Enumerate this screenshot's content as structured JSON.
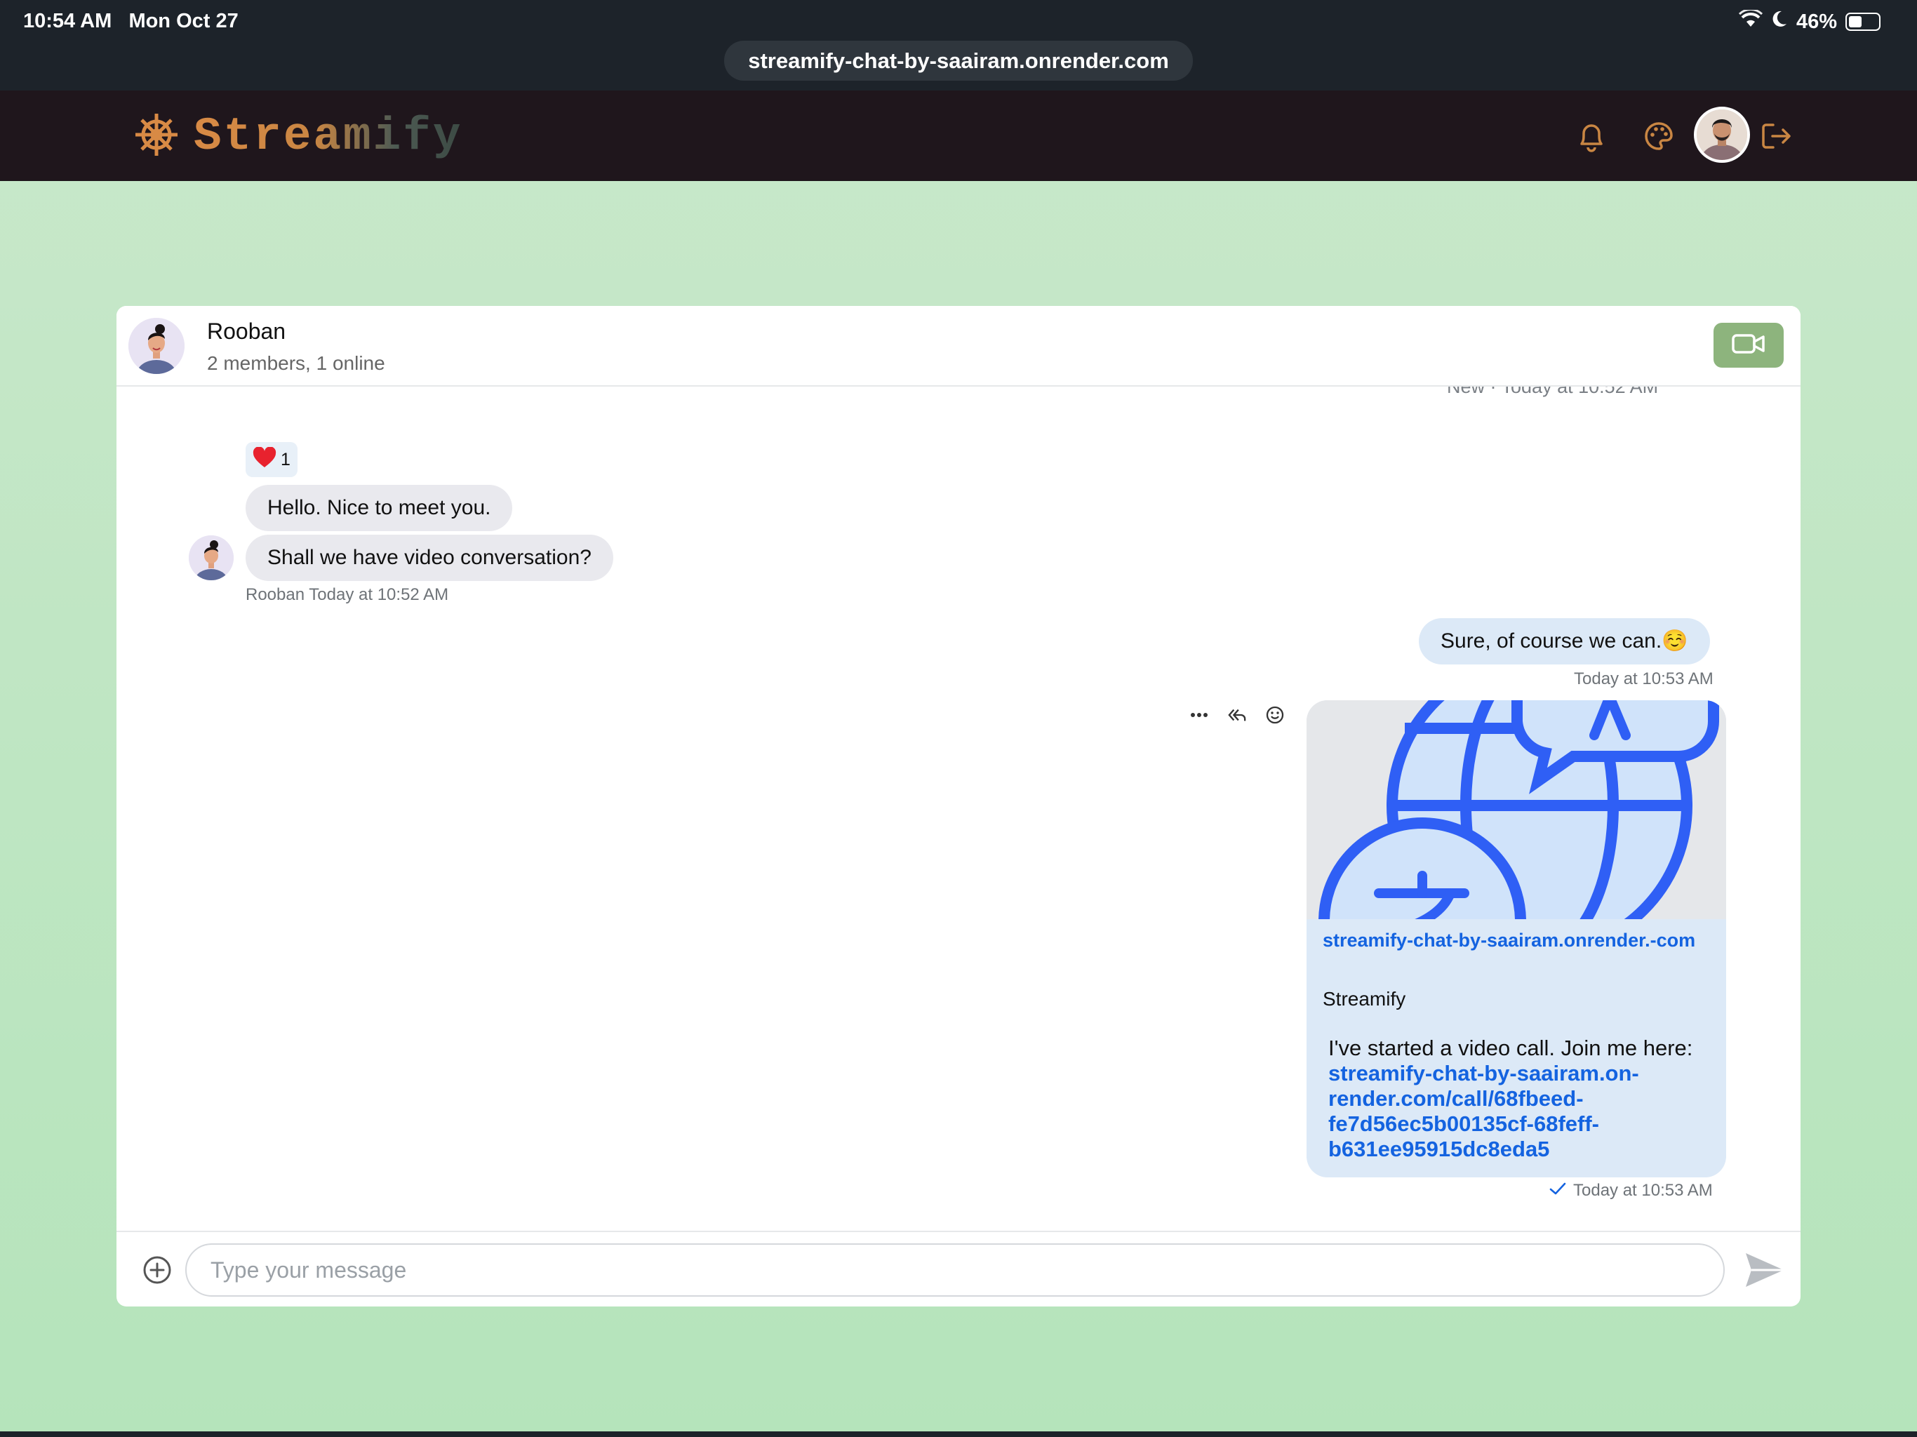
{
  "status_bar": {
    "time": "10:54 AM",
    "date": "Mon Oct 27",
    "battery": "46%",
    "battery_level": 0.46,
    "icons": [
      "wifi-icon",
      "moon-icon",
      "battery-icon"
    ]
  },
  "browser": {
    "url": "streamify-chat-by-saairam.onrender.com"
  },
  "header": {
    "brand": "Streamify",
    "logo_icon": "ship-wheel-icon",
    "actions": [
      "bell-icon",
      "palette-icon",
      "avatar",
      "logout-icon"
    ]
  },
  "colors": {
    "accent": "#8db47d",
    "brand_orange": "#d88a45",
    "link": "#1463e0"
  },
  "chat": {
    "channel_name": "Rooban",
    "members_status": "2 members, 1 online",
    "clipped_date": "New · Today at 10:52 AM",
    "messages": [
      {
        "direction": "incoming",
        "reaction": {
          "emoji": "❤️",
          "count": "1"
        },
        "texts": [
          "Hello. Nice to meet you.",
          "Shall we have video conversation?"
        ],
        "meta": "Rooban Today at 10:52 AM"
      },
      {
        "direction": "outgoing",
        "text": "Sure, of course we can.☺️",
        "meta": "Today at 10:53 AM"
      },
      {
        "direction": "outgoing",
        "attachment": {
          "link": "streamify-chat-by-saairam.onrender.-com",
          "title": "Streamify"
        },
        "text_prefix": "I've started a video call. Join me here: ",
        "link_text": "streamify-chat-by-saairam.on-render.com/call/68fbeed-fe7d56ec5b00135cf-68feff-b631ee95915dc8eda5",
        "meta": "Today at 10:53 AM",
        "status_icon": "check-icon"
      }
    ]
  },
  "composer": {
    "placeholder": "Type your message"
  }
}
